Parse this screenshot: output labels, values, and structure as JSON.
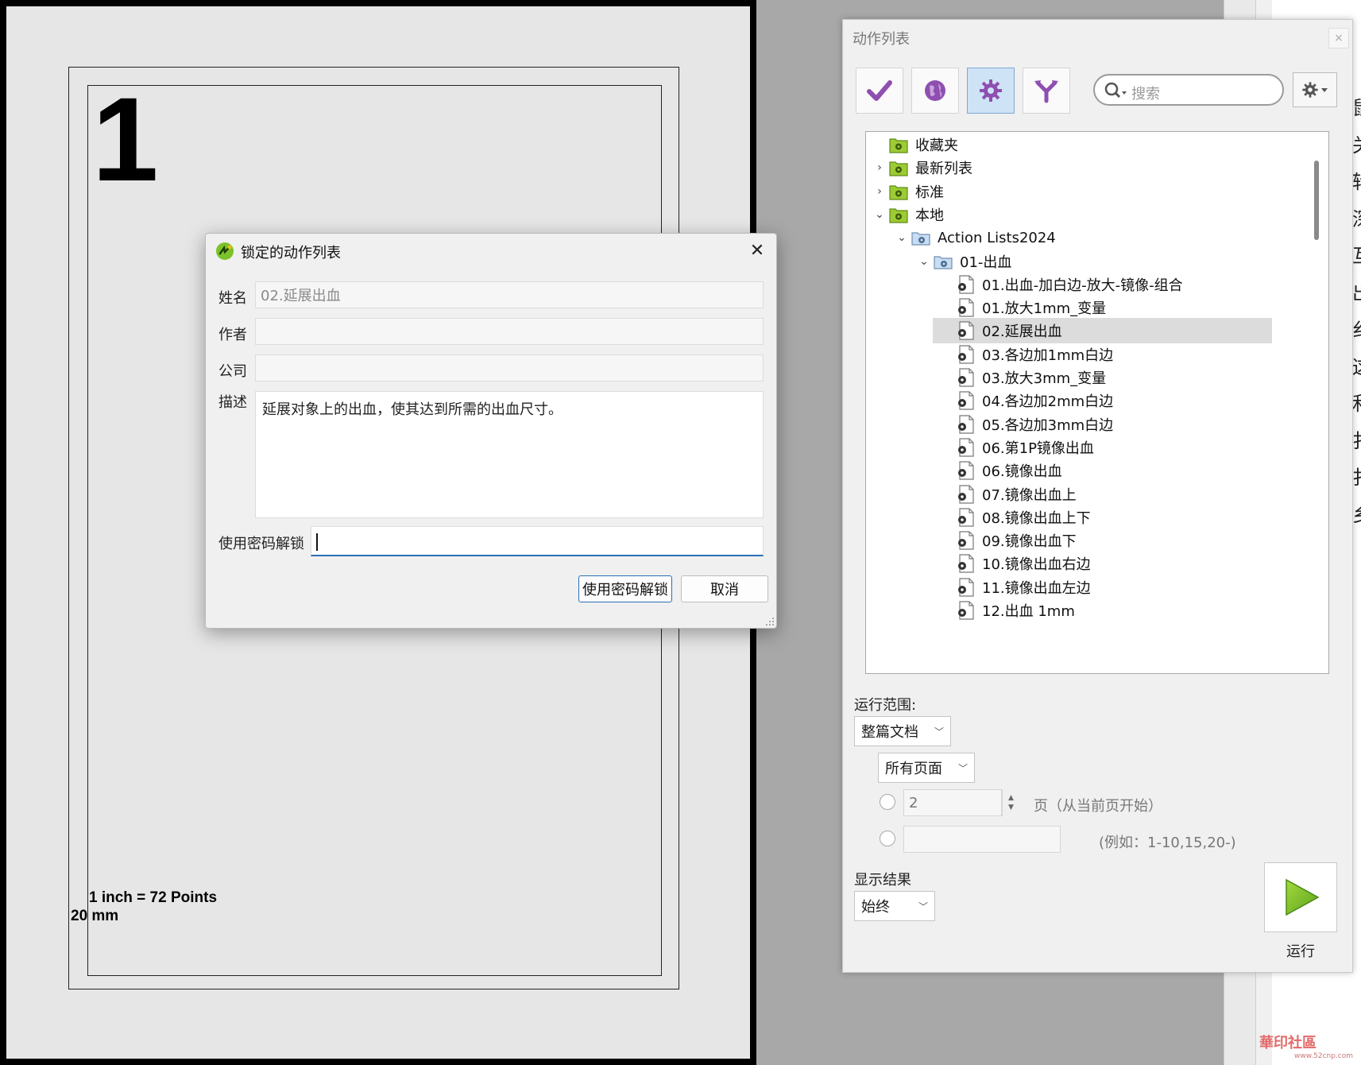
{
  "document": {
    "page_number": "1",
    "scale_note": "1 inch = 72 Points",
    "margin_note": "20 mm"
  },
  "side_glyphs": [
    "鼠",
    "关",
    "转",
    "深",
    "互",
    "出",
    "纟",
    "这",
    "和",
    "扌",
    "扌",
    "乡"
  ],
  "action_panel": {
    "title": "动作列表",
    "close_glyph": "×",
    "toolbar": [
      {
        "name": "check",
        "icon": "checkmark-icon"
      },
      {
        "name": "globe",
        "icon": "globe-icon"
      },
      {
        "name": "gear",
        "icon": "gear-icon",
        "active": true
      },
      {
        "name": "split",
        "icon": "split-arrows-icon"
      }
    ],
    "search_placeholder": "搜索",
    "tree": [
      {
        "label": "收藏夹",
        "level": 0,
        "caret": "",
        "kind": "folder"
      },
      {
        "label": "最新列表",
        "level": 0,
        "caret": ">",
        "kind": "folder"
      },
      {
        "label": "标准",
        "level": 0,
        "caret": ">",
        "kind": "folder"
      },
      {
        "label": "本地",
        "level": 0,
        "caret": "v",
        "kind": "folder"
      },
      {
        "label": "Action Lists2024",
        "level": 1,
        "caret": "v",
        "kind": "blue-folder"
      },
      {
        "label": "01-出血",
        "level": 2,
        "caret": "v",
        "kind": "blue-folder"
      },
      {
        "label": "01.出血-加白边-放大-镜像-组合",
        "level": 3,
        "caret": "",
        "kind": "action"
      },
      {
        "label": "01.放大1mm_变量",
        "level": 3,
        "caret": "",
        "kind": "action"
      },
      {
        "label": "02.延展出血",
        "level": 3,
        "caret": "",
        "kind": "action",
        "selected": true
      },
      {
        "label": "03.各边加1mm白边",
        "level": 3,
        "caret": "",
        "kind": "action"
      },
      {
        "label": "03.放大3mm_变量",
        "level": 3,
        "caret": "",
        "kind": "action"
      },
      {
        "label": "04.各边加2mm白边",
        "level": 3,
        "caret": "",
        "kind": "action"
      },
      {
        "label": "05.各边加3mm白边",
        "level": 3,
        "caret": "",
        "kind": "action"
      },
      {
        "label": "06.第1P镜像出血",
        "level": 3,
        "caret": "",
        "kind": "action"
      },
      {
        "label": "06.镜像出血",
        "level": 3,
        "caret": "",
        "kind": "action"
      },
      {
        "label": "07.镜像出血上",
        "level": 3,
        "caret": "",
        "kind": "action"
      },
      {
        "label": "08.镜像出血上下",
        "level": 3,
        "caret": "",
        "kind": "action"
      },
      {
        "label": "09.镜像出血下",
        "level": 3,
        "caret": "",
        "kind": "action"
      },
      {
        "label": "10.镜像出血右边",
        "level": 3,
        "caret": "",
        "kind": "action"
      },
      {
        "label": "11.镜像出血左边",
        "level": 3,
        "caret": "",
        "kind": "action"
      },
      {
        "label": "12.出血 1mm",
        "level": 3,
        "caret": "",
        "kind": "action"
      }
    ],
    "run_scope_label": "运行范围:",
    "scope_select": "整篇文档",
    "pages_select": "所有页面",
    "page_count_value": "2",
    "page_count_suffix": "页（从当前页开始）",
    "range_hint": "(例如：1-10,15,20-)",
    "show_result_label": "显示结果",
    "show_result_select": "始终",
    "run_label": "运行"
  },
  "dialog": {
    "title": "锁定的动作列表",
    "close_glyph": "✕",
    "name_label": "姓名",
    "name_value": "02.延展出血",
    "author_label": "作者",
    "author_value": "",
    "company_label": "公司",
    "company_value": "",
    "desc_label": "描述",
    "desc_value": "延展对象上的出血，使其达到所需的出血尺寸。",
    "password_label": "使用密码解锁",
    "unlock_button": "使用密码解锁",
    "cancel_button": "取消"
  },
  "watermark": {
    "text": "華印社區",
    "url": "www.52cnp.com"
  },
  "colors": {
    "accent": "#2a6fb5",
    "folder_green": "#8cbd2a",
    "selected_row": "#dcdcdc",
    "run_green": "#7cc22a"
  }
}
